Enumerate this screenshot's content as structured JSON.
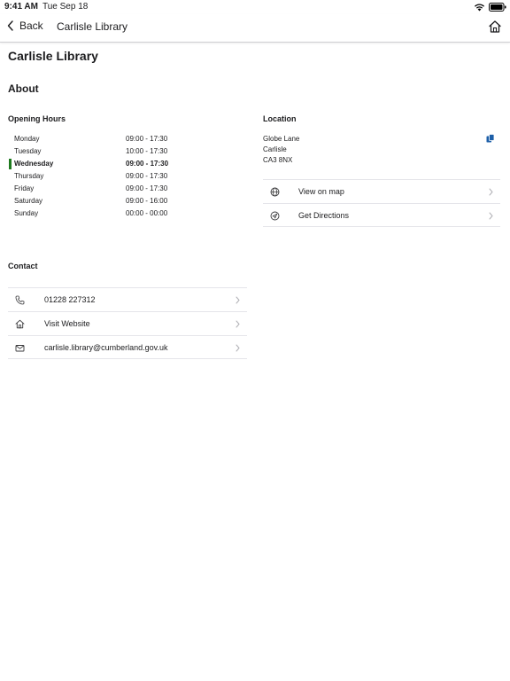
{
  "status_bar": {
    "time": "9:41 AM",
    "date": "Tue Sep 18",
    "wifi_icon": "wifi-icon",
    "battery_icon": "battery-icon"
  },
  "nav": {
    "back_label": "Back",
    "title": "Carlisle Library",
    "home_icon": "home-icon"
  },
  "page": {
    "title": "Carlisle Library",
    "about_heading": "About"
  },
  "opening_hours": {
    "heading": "Opening Hours",
    "today_color": "#1f7a1f",
    "rows": [
      {
        "day": "Monday",
        "hours": "09:00 - 17:30",
        "today": false
      },
      {
        "day": "Tuesday",
        "hours": "10:00 - 17:30",
        "today": false
      },
      {
        "day": "Wednesday",
        "hours": "09:00 - 17:30",
        "today": true
      },
      {
        "day": "Thursday",
        "hours": "09:00 - 17:30",
        "today": false
      },
      {
        "day": "Friday",
        "hours": "09:00 - 17:30",
        "today": false
      },
      {
        "day": "Saturday",
        "hours": "09:00 - 16:00",
        "today": false
      },
      {
        "day": "Sunday",
        "hours": "00:00 - 00:00",
        "today": false
      }
    ]
  },
  "location": {
    "heading": "Location",
    "address_lines": [
      "Globe Lane",
      "Carlisle",
      "CA3 8NX"
    ],
    "copy_icon": "copy-icon",
    "copy_icon_color": "#1d5fa8",
    "links": [
      {
        "label": "View on map",
        "icon": "globe-icon"
      },
      {
        "label": "Get Directions",
        "icon": "directions-icon"
      }
    ]
  },
  "contact": {
    "heading": "Contact",
    "links": [
      {
        "label": "01228 227312",
        "icon": "phone-icon"
      },
      {
        "label": "Visit Website",
        "icon": "home-icon"
      },
      {
        "label": "carlisle.library@cumberland.gov.uk",
        "icon": "mail-icon"
      }
    ]
  }
}
